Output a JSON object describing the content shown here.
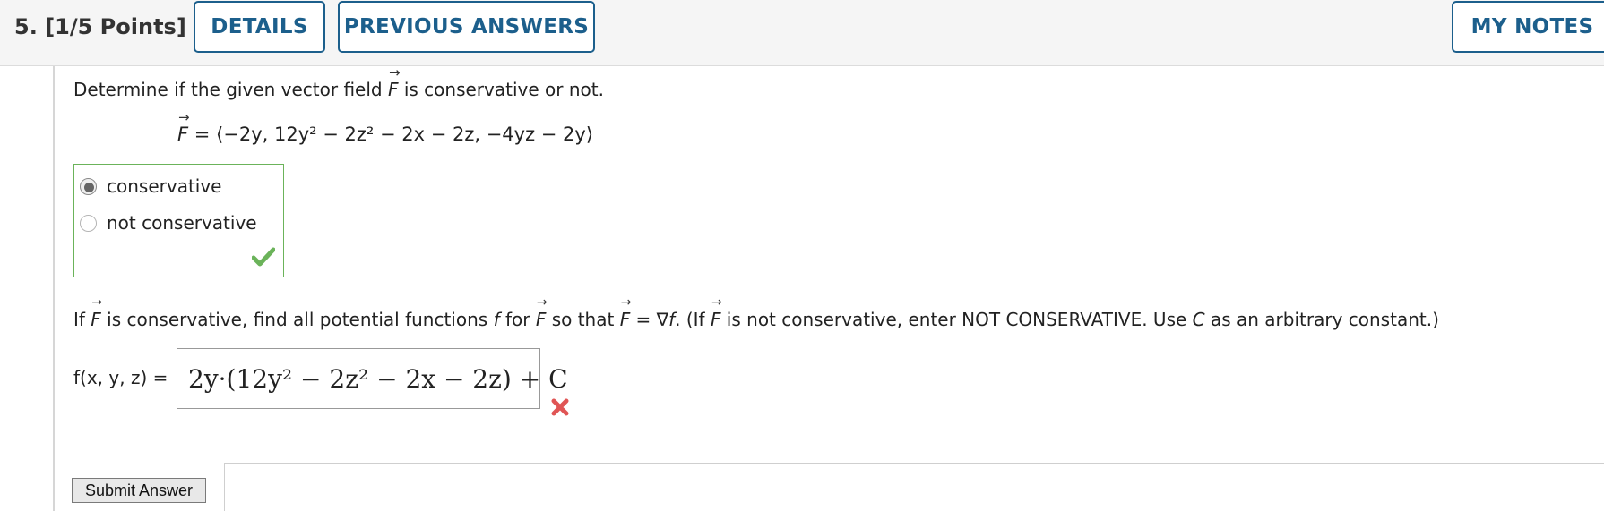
{
  "header": {
    "question_number": "5.",
    "points": "[1/5 Points]",
    "details_label": "DETAILS",
    "previous_answers_label": "PREVIOUS ANSWERS",
    "my_notes_label": "MY NOTES"
  },
  "question": {
    "prompt_before": "Determine if the given vector field ",
    "vector_symbol": "F",
    "prompt_after": " is conservative or not."
  },
  "field": {
    "lhs": "F",
    "equals": " = ",
    "components": "⟨−2y, 12y² − 2z² − 2x − 2z, −4yz − 2y⟩"
  },
  "choices": {
    "options": [
      "conservative",
      "not conservative"
    ],
    "selected": "conservative",
    "status": "correct"
  },
  "part_b": {
    "text_1": "If ",
    "text_2": " is conservative, find all potential functions ",
    "f": "f",
    "text_3": " for ",
    "text_4": " so that ",
    "text_5": " = ∇",
    "text_6": ". (If ",
    "text_7": " is not conservative, enter NOT CONSERVATIVE. Use ",
    "c": "C",
    "text_8": " as an arbitrary constant.)"
  },
  "answer": {
    "label": "f(x, y, z) =",
    "value": "2y·(12y² − 2z² − 2x − 2z) + C",
    "status": "incorrect"
  },
  "submit_label": "Submit Answer",
  "colors": {
    "brand_blue": "#1c5f8c",
    "correct_green": "#6bb35a",
    "incorrect_red": "#e05555"
  }
}
